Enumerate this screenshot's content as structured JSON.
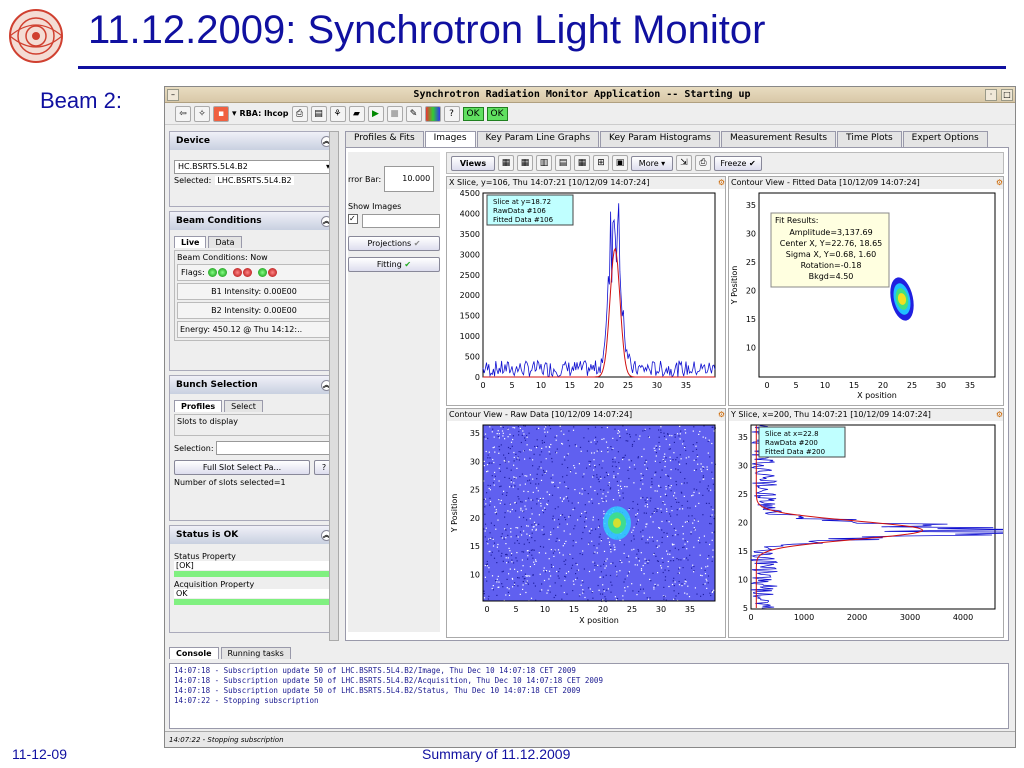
{
  "slide": {
    "title": "11.12.2009: Synchrotron Light Monitor",
    "beam_label": "Beam 2:",
    "footer_date": "11-12-09",
    "footer_summary": "Summary of 11.12.2009",
    "colors": {
      "title": "#1010a0"
    }
  },
  "app": {
    "title": "Synchrotron Radiation Monitor Application -- Starting up",
    "toolbar": {
      "rba_label": "RBA: lhcop",
      "ok1": "OK",
      "ok2": "OK"
    },
    "device": {
      "header": "Device",
      "selector": "HC.BSRTS.5L4.B2",
      "selected_label": "Selected:",
      "selected_value": "LHC.BSRTS.5L4.B2"
    },
    "beam_conditions": {
      "header": "Beam Conditions",
      "tabs": [
        "Live",
        "Data"
      ],
      "group_title": "Beam Conditions: Now",
      "flags_label": "Flags:",
      "b1_intensity": "B1 Intensity: 0.00E00",
      "b2_intensity": "B2 Intensity: 0.00E00",
      "energy": "Energy: 450.12 @ Thu 14:12:.."
    },
    "bunch_selection": {
      "header": "Bunch Selection",
      "tabs": [
        "Profiles",
        "Select"
      ],
      "slots_label": "Slots to display",
      "selection_label": "Selection:",
      "full_slot_button": "Full Slot Select Pa...",
      "help_button": "?",
      "num_slots": "Number of slots selected=1"
    },
    "status": {
      "header": "Status is OK",
      "status_property": "Status Property",
      "status_value": "[OK]",
      "acq_property": "Acquisition Property",
      "acq_value": "OK"
    },
    "main_tabs": [
      "Profiles & Fits",
      "Images",
      "Key Param Line Graphs",
      "Key Param Histograms",
      "Measurement Results",
      "Time Plots",
      "Expert Options"
    ],
    "controls": {
      "error_bar_label": "rror Bar:",
      "error_bar_value": "10.000",
      "show_images": "Show Images",
      "projections": "Projections",
      "fitting": "Fitting"
    },
    "plotbar": {
      "views": "Views",
      "more": "More",
      "freeze": "Freeze"
    },
    "plots": {
      "xslice_title": "X Slice, y=106, Thu 14:07:21  [10/12/09 14:07:24]",
      "contour_fit_title": "Contour View - Fitted Data  [10/12/09 14:07:24]",
      "contour_raw_title": "Contour View - Raw Data  [10/12/09 14:07:24]",
      "yslice_title": "Y Slice, x=200, Thu 14:07:21  [10/12/09 14:07:24]",
      "xslice_legend": [
        "Slice at y=18.72",
        "RawData #106",
        "Fitted Data #106"
      ],
      "yslice_legend": [
        "Slice at x=22.8",
        "RawData #200",
        "Fitted Data #200"
      ],
      "fit_results": {
        "title": "Fit Results:",
        "lines": [
          "Amplitude=3,137.69",
          "Center X, Y=22.76, 18.65",
          "Sigma X, Y=0.68, 1.60",
          "Rotation=-0.18",
          "Bkgd=4.50"
        ]
      },
      "x_position_label": "X position",
      "y_position_label": "Y Position",
      "x_position_label_lower": "X position",
      "xslice_yticks": [
        "4500",
        "4000",
        "3500",
        "3000",
        "2500",
        "2000",
        "1500",
        "1000",
        "500",
        "0"
      ],
      "pos_ticks": [
        "0",
        "5",
        "10",
        "15",
        "20",
        "25",
        "30",
        "35"
      ],
      "ypos_ticks": [
        "35",
        "30",
        "25",
        "20",
        "15",
        "10"
      ],
      "ypos_ticks_y": [
        "35",
        "30",
        "25",
        "20",
        "15",
        "10",
        "5"
      ],
      "yslice_xticks": [
        "0",
        "1000",
        "2000",
        "3000",
        "4000"
      ]
    },
    "console": {
      "tabs": [
        "Console",
        "Running tasks"
      ],
      "lines": [
        "14:07:18 - Subscription update 50 of LHC.BSRTS.5L4.B2/Image, Thu Dec 10 14:07:18 CET 2009",
        "14:07:18 - Subscription update 50 of LHC.BSRTS.5L4.B2/Acquisition, Thu Dec 10 14:07:18 CET 2009",
        "14:07:18 - Subscription update 50 of LHC.BSRTS.5L4.B2/Status, Thu Dec 10 14:07:18 CET 2009",
        "14:07:22 - Stopping subscription"
      ],
      "status": "14:07:22 - Stopping subscription"
    }
  }
}
